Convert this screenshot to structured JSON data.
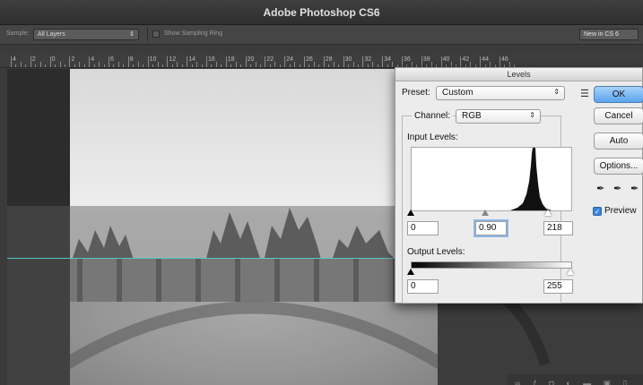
{
  "window": {
    "title": "Adobe Photoshop CS6"
  },
  "options_bar": {
    "sample_label": "Sample:",
    "sample_value": "All Layers",
    "show_sampling_ring_label": "Show Sampling Ring",
    "workspace_value": "New in CS 6"
  },
  "ruler": {
    "labels": [
      "4",
      "2",
      "0",
      "2",
      "4",
      "6",
      "8",
      "10",
      "12",
      "14",
      "16",
      "18",
      "20",
      "22",
      "24",
      "26",
      "28",
      "30",
      "32",
      "34",
      "36",
      "38",
      "40",
      "42",
      "44",
      "46"
    ]
  },
  "levels_dialog": {
    "title": "Levels",
    "preset_label": "Preset:",
    "preset_value": "Custom",
    "channel_label": "Channel:",
    "channel_value": "RGB",
    "input_levels_label": "Input Levels:",
    "input_black": "0",
    "input_gamma": "0.90",
    "input_white": "218",
    "output_levels_label": "Output Levels:",
    "output_black": "0",
    "output_white": "255",
    "buttons": {
      "ok": "OK",
      "cancel": "Cancel",
      "auto": "Auto",
      "options": "Options..."
    },
    "preview_label": "Preview",
    "preview_checked": true
  },
  "icons": {
    "preset_menu": "preset-options-icon",
    "black_eyedropper": "black-eyedropper-icon",
    "gray_eyedropper": "gray-eyedropper-icon",
    "white_eyedropper": "white-eyedropper-icon"
  },
  "colors": {
    "guide": "#58c6c6",
    "ok_button": "#5aa4ee"
  }
}
